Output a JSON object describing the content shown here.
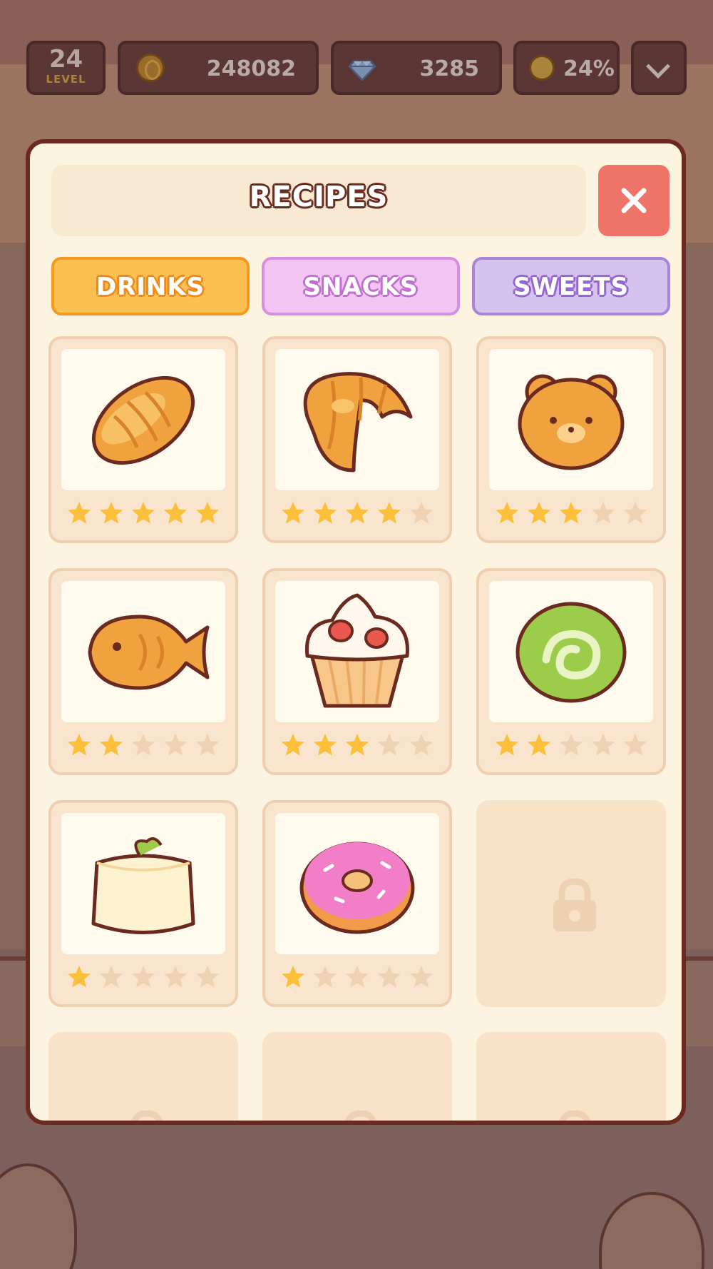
{
  "hud": {
    "level_number": "24",
    "level_label": "LEVEL",
    "coins": "248082",
    "gems": "3285",
    "happiness": "24%"
  },
  "modal": {
    "title": "RECIPES",
    "tabs": [
      {
        "label": "DRINKS",
        "color": "#fcbf52"
      },
      {
        "label": "SNACKS",
        "color": "#f2c4f2"
      },
      {
        "label": "SWEETS",
        "color": "#d4c3ee"
      }
    ],
    "recipes": [
      {
        "icon": "bread-loaf-icon",
        "stars": 5,
        "locked": false
      },
      {
        "icon": "croissant-icon",
        "stars": 4,
        "locked": false
      },
      {
        "icon": "bear-bun-icon",
        "stars": 3,
        "locked": false
      },
      {
        "icon": "taiyaki-icon",
        "stars": 2,
        "locked": false
      },
      {
        "icon": "strawberry-cupcake-icon",
        "stars": 3,
        "locked": false
      },
      {
        "icon": "matcha-roll-icon",
        "stars": 2,
        "locked": false
      },
      {
        "icon": "cheesecake-icon",
        "stars": 1,
        "locked": false
      },
      {
        "icon": "pink-donut-icon",
        "stars": 1,
        "locked": false
      },
      {
        "icon": "lock-icon",
        "stars": 0,
        "locked": true
      },
      {
        "icon": "lock-icon",
        "stars": 0,
        "locked": true
      },
      {
        "icon": "lock-icon",
        "stars": 0,
        "locked": true
      },
      {
        "icon": "lock-icon",
        "stars": 0,
        "locked": true
      }
    ],
    "max_stars": 5
  },
  "colors": {
    "star_filled": "#fbbf3a",
    "star_empty": "#efd1b4",
    "close_button": "#ee7369",
    "modal_border": "#6b2a20"
  }
}
